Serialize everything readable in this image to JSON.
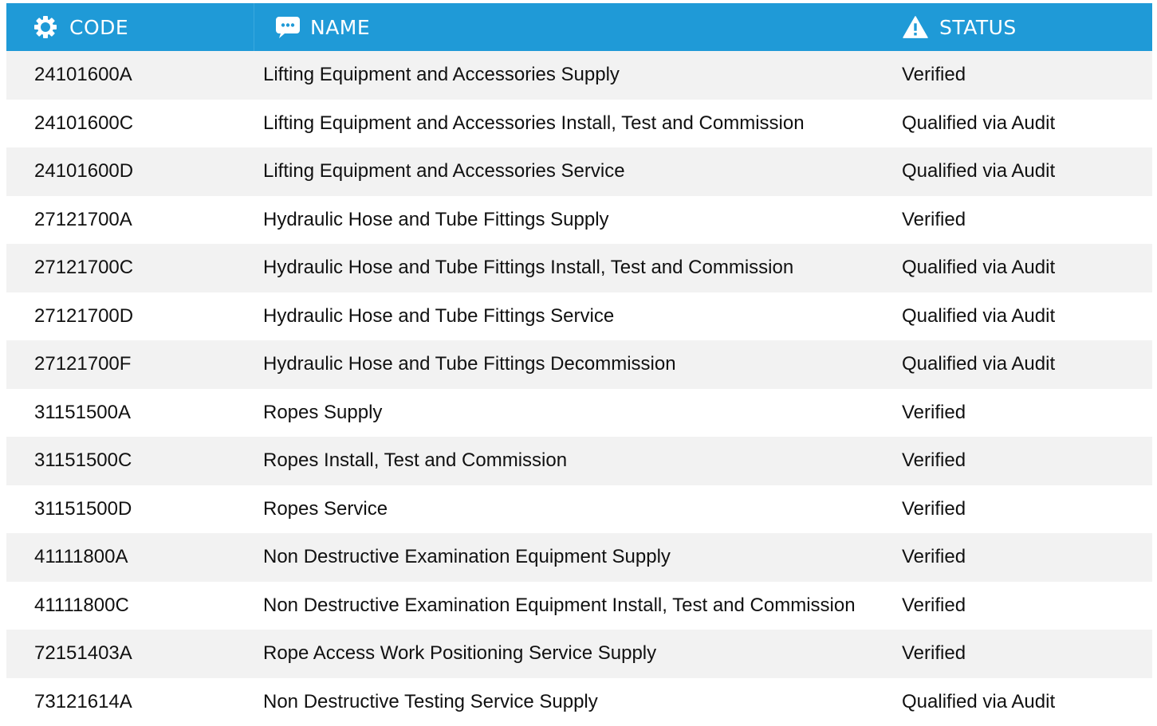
{
  "header": {
    "code_label": "CODE",
    "name_label": "NAME",
    "status_label": "STATUS",
    "code_icon": "gear-icon",
    "name_icon": "chat-bubble-icon",
    "status_icon": "warning-icon",
    "bg_color": "#1f9ad7"
  },
  "rows": [
    {
      "code": "24101600A",
      "name": "Lifting Equipment and Accessories Supply",
      "status": "Verified"
    },
    {
      "code": "24101600C",
      "name": "Lifting Equipment and Accessories Install, Test and Commission",
      "status": "Qualified via Audit"
    },
    {
      "code": "24101600D",
      "name": "Lifting Equipment and Accessories Service",
      "status": "Qualified via Audit"
    },
    {
      "code": "27121700A",
      "name": "Hydraulic Hose and Tube Fittings Supply",
      "status": "Verified"
    },
    {
      "code": "27121700C",
      "name": "Hydraulic Hose and Tube Fittings Install, Test and Commission",
      "status": "Qualified via Audit"
    },
    {
      "code": "27121700D",
      "name": "Hydraulic Hose and Tube Fittings Service",
      "status": "Qualified via Audit"
    },
    {
      "code": "27121700F",
      "name": "Hydraulic Hose and Tube Fittings Decommission",
      "status": "Qualified via Audit"
    },
    {
      "code": "31151500A",
      "name": "Ropes Supply",
      "status": "Verified"
    },
    {
      "code": "31151500C",
      "name": "Ropes Install, Test and Commission",
      "status": "Verified"
    },
    {
      "code": "31151500D",
      "name": "Ropes Service",
      "status": "Verified"
    },
    {
      "code": "41111800A",
      "name": "Non Destructive Examination Equipment Supply",
      "status": "Verified"
    },
    {
      "code": "41111800C",
      "name": "Non Destructive Examination Equipment Install, Test and Commission",
      "status": "Verified"
    },
    {
      "code": "72151403A",
      "name": "Rope Access Work Positioning Service Supply",
      "status": "Verified"
    },
    {
      "code": "73121614A",
      "name": "Non Destructive Testing Service Supply",
      "status": "Qualified via Audit"
    }
  ]
}
